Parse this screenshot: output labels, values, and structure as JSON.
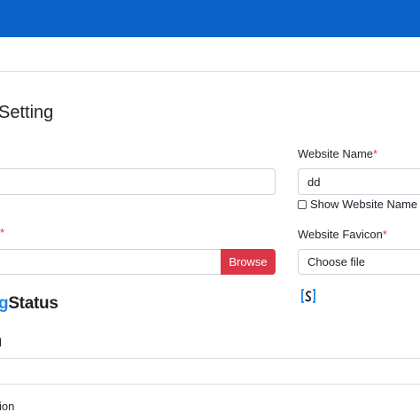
{
  "header": {
    "bar_color": "#0a63c9"
  },
  "page": {
    "title": "Setting"
  },
  "left": {
    "file_label_suffix": "*",
    "browse_label": "Browse",
    "logo_partial_a": "g",
    "logo_partial_b": "Status",
    "cut_label_1": "l",
    "cut_label_2": "ion"
  },
  "right": {
    "website_name_label": "Website Name",
    "website_name_value": "dd",
    "required_mark": "*",
    "show_name_label": "Show Website Name",
    "favicon_label": "Website Favicon",
    "choose_file_label": "Choose file"
  },
  "colors": {
    "primary": "#0a63c9",
    "danger": "#dc3545",
    "accent": "#1e88e5"
  },
  "icons": {
    "favicon_preview": "brand-logo-icon"
  }
}
